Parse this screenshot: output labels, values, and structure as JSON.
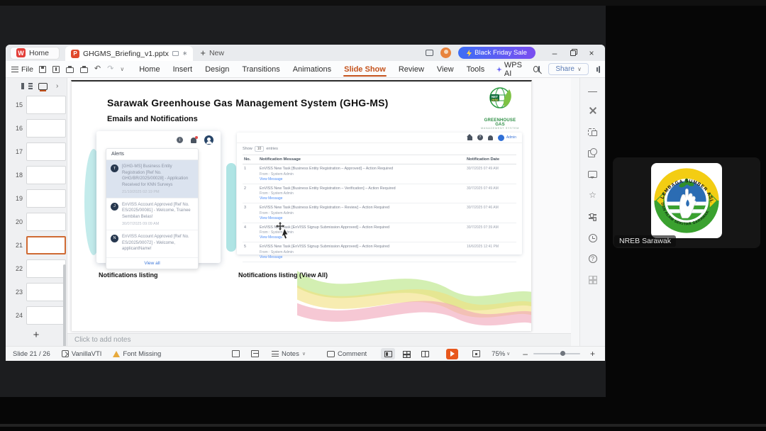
{
  "glyphs": {
    "w": "W",
    "p": "P",
    "plus": "+",
    "minimize": "–",
    "close": "×",
    "chevron_right": "›",
    "chevron_down": "∨",
    "undo": "↶",
    "redo": "↷",
    "ellipsis": "···",
    "star": "☆",
    "help": "?",
    "info": "i",
    "dot": "∗",
    "bolt": "⚡"
  },
  "titlebar": {
    "home_tab": "Home",
    "doc_tab": "GHGMS_Briefing_v1.pptx",
    "new_label": "New",
    "promo": "Black Friday Sale"
  },
  "menubar": {
    "file": "File",
    "items": [
      {
        "label": "Home"
      },
      {
        "label": "Insert"
      },
      {
        "label": "Design"
      },
      {
        "label": "Transitions"
      },
      {
        "label": "Animations"
      },
      {
        "label": "Slide Show",
        "cls": "active"
      },
      {
        "label": "Review"
      },
      {
        "label": "View"
      },
      {
        "label": "Tools"
      }
    ],
    "wps_ai": "WPS AI",
    "share": "Share"
  },
  "slide_panel": {
    "slides": [
      {
        "num": "15",
        "cls": "v-lines"
      },
      {
        "num": "16",
        "cls": "v-orange"
      },
      {
        "num": "17",
        "cls": "v-lines"
      },
      {
        "num": "18",
        "cls": "v-blob"
      },
      {
        "num": "19",
        "cls": "v-blue"
      },
      {
        "num": "20",
        "cls": "v-lines"
      },
      {
        "num": "21",
        "cls": "v-current sel"
      },
      {
        "num": "22",
        "cls": "v-dark"
      },
      {
        "num": "23",
        "cls": "v-teal"
      },
      {
        "num": "24",
        "cls": "v-wave"
      }
    ]
  },
  "slide": {
    "title": "Sarawak Greenhouse Gas Management System (GHG-MS)",
    "subtitle": "Emails and Notifications",
    "logo": {
      "badge1": "NET",
      "badge2": "2050",
      "line1": "GREENHOUSE GAS",
      "line2": "MANAGEMENT SYSTEM"
    },
    "alerts": {
      "header": "Alerts",
      "items": [
        {
          "initial": "T",
          "text": "[GHG-MS] Business Entity Registration [Ref No. GHG/BR/2025/00028] - Application Received for KNN Surveys",
          "time": "21/10/2025 02:19 PM",
          "cls": "hl"
        },
        {
          "initial": "J",
          "text": "EnVISS Account Approved [Ref No. ES/2025/00081] - Welcome, Trainee Sembilan Belas!",
          "time": "30/07/2025 09:09 AM"
        },
        {
          "initial": "N",
          "text": "EnVISS Account Approved [Ref No. ES/2025/00072] - Welcome, applicantName!",
          "time": ""
        }
      ],
      "view_all": "View all"
    },
    "table": {
      "user": "Admin",
      "show_label": "Show",
      "show_value": "10",
      "entries_label": "entries",
      "columns": {
        "no": "No.",
        "message": "Notification Message",
        "date": "Notification Date"
      },
      "rows": [
        {
          "no": "1",
          "msg": "EnVISS New Task [Business Entity Registration – Approved] – Action Required",
          "from": "From : System Admin",
          "link": "View Message",
          "date": "30/7/2025 07:49 AM"
        },
        {
          "no": "2",
          "msg": "EnVISS New Task [Business Entity Registration – Verification] – Action Required",
          "from": "From : System Admin",
          "link": "View Message",
          "date": "30/7/2025 07:49 AM"
        },
        {
          "no": "3",
          "msg": "EnVISS New Task [Business Entity Registration – Review] – Action Required",
          "from": "From : System Admin",
          "link": "View Message",
          "date": "30/7/2025 07:46 AM"
        },
        {
          "no": "4",
          "msg": "EnVISS New Task [EnVISS Signup Submission Approved] – Action Required",
          "from": "From : System Admin",
          "link": "View Message",
          "date": "30/7/2025 07:39 AM"
        },
        {
          "no": "5",
          "msg": "EnVISS New Task [EnVISS Signup Submission Approved] – Action Required",
          "from": "From : System Admin",
          "link": "View Message",
          "date": "16/6/2025 12:41 PM"
        }
      ]
    },
    "caption_left": "Notifications listing",
    "caption_right": "Notifications listing (View All)"
  },
  "notes_bar": {
    "placeholder": "Click to add notes"
  },
  "statusbar": {
    "slide_indicator": "Slide 21 / 26",
    "theme": "VanillaVTI",
    "font_missing": "Font Missing",
    "notes": "Notes",
    "comment": "Comment",
    "zoom": "75%"
  },
  "meeting": {
    "participant_label": "NREB Sarawak",
    "logo_top_text": "LEMBAGA SUMBER ASLI",
    "logo_bottom_text": "DAN ALAM SEKITAR SARAWAK"
  }
}
